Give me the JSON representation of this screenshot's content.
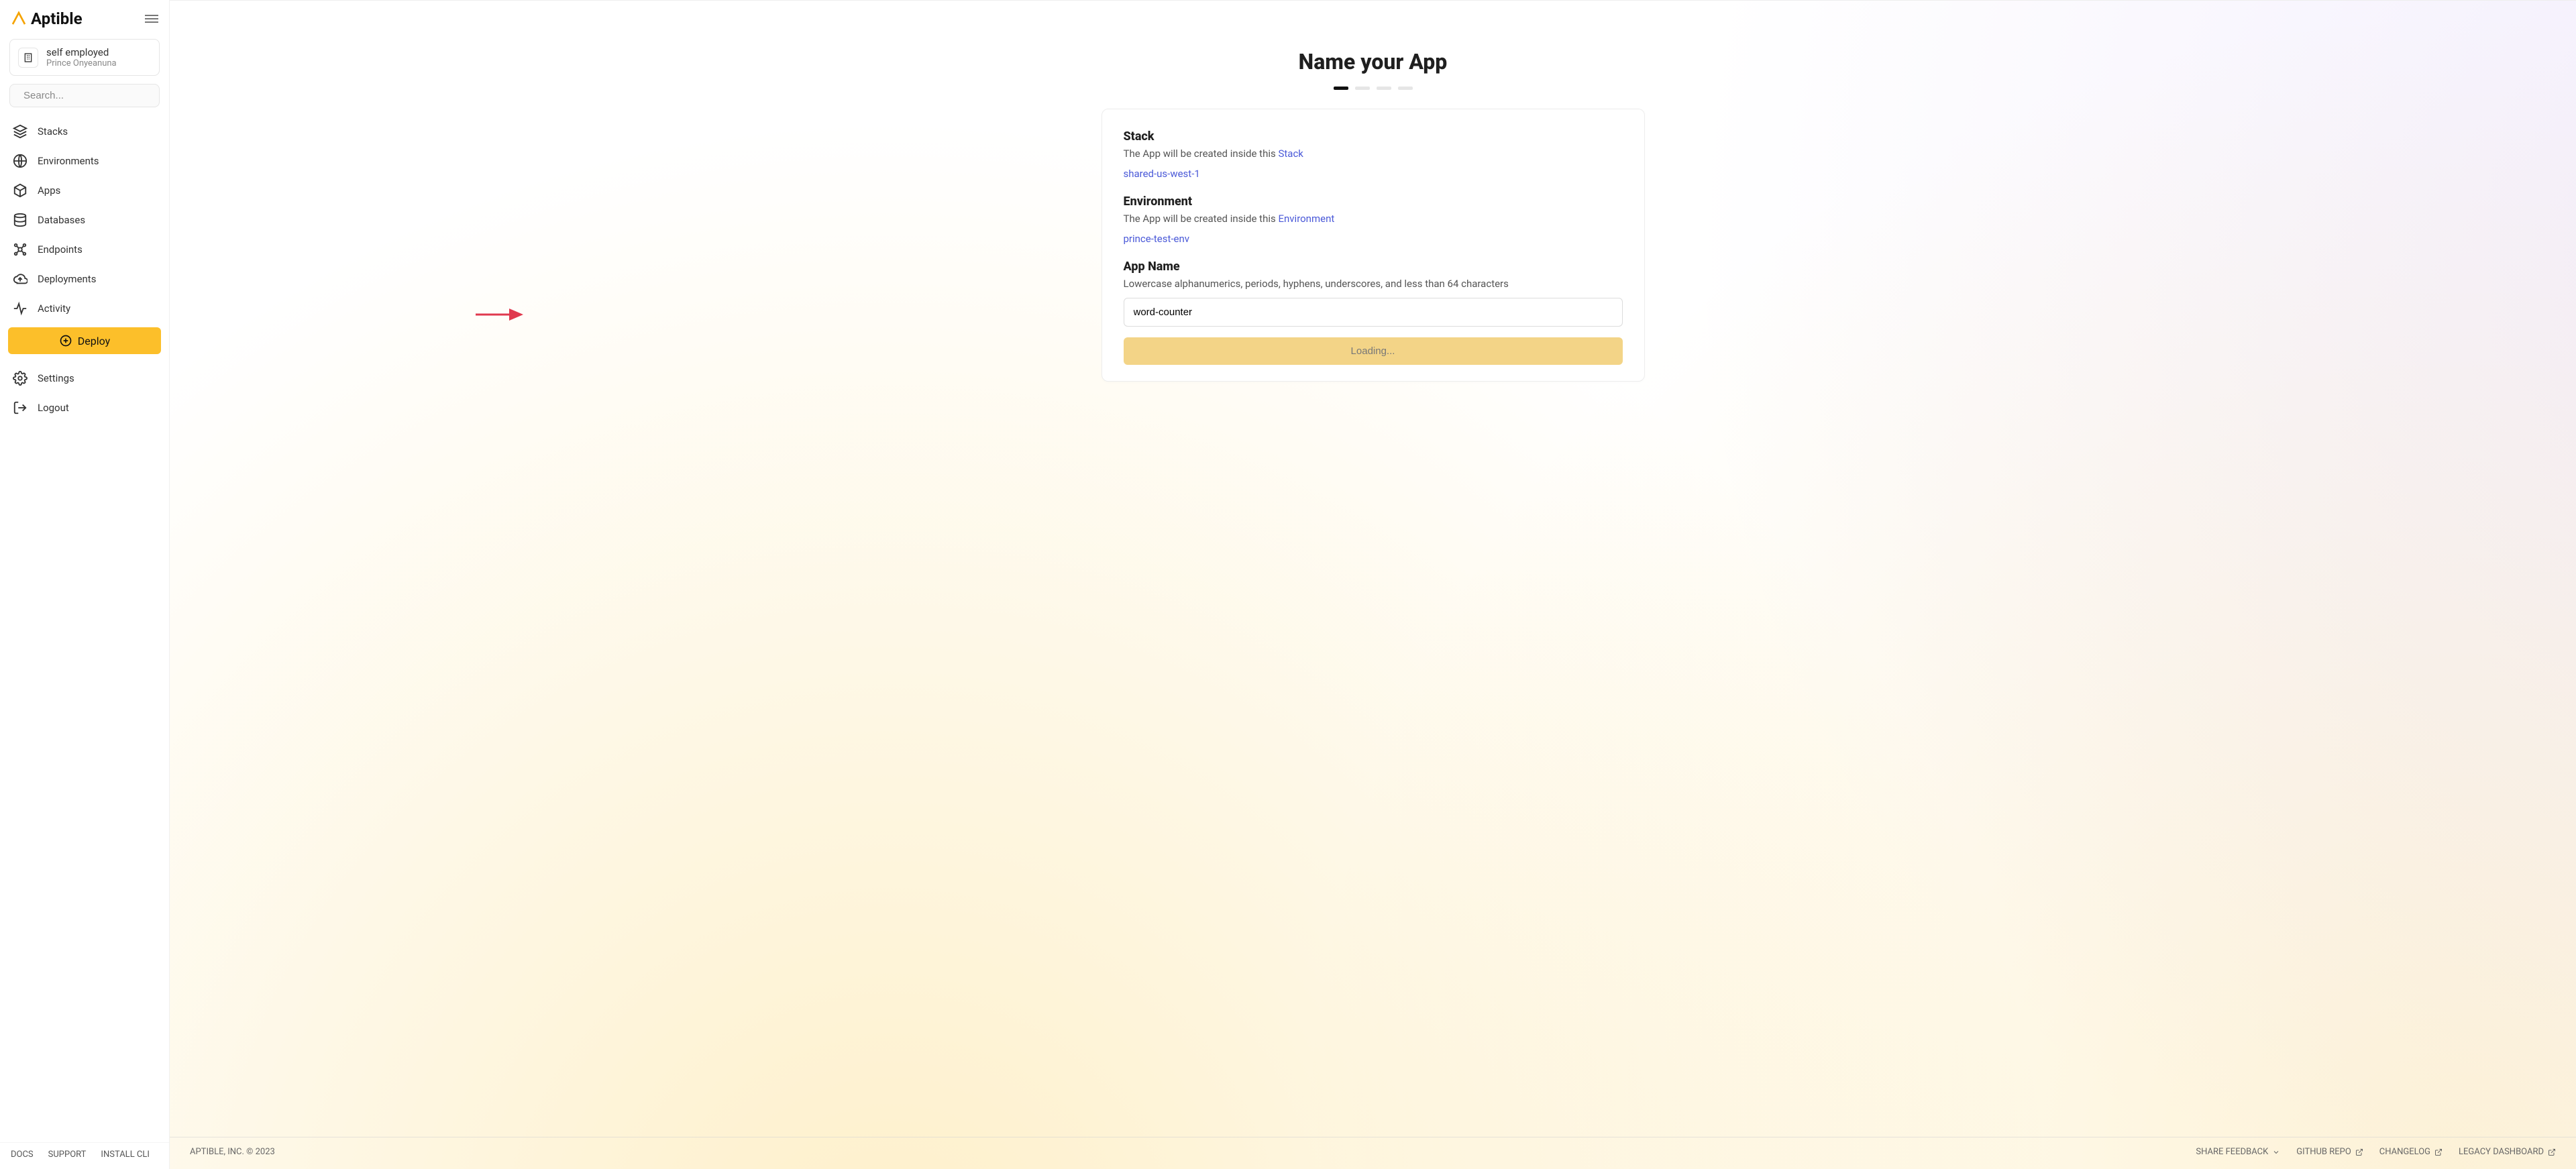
{
  "brand": {
    "name": "Aptible"
  },
  "org": {
    "title": "self employed",
    "sub": "Prince Onyeanuna"
  },
  "search": {
    "placeholder": "Search..."
  },
  "nav": {
    "stacks": "Stacks",
    "environments": "Environments",
    "apps": "Apps",
    "databases": "Databases",
    "endpoints": "Endpoints",
    "deployments": "Deployments",
    "activity": "Activity",
    "deploy_btn": "Deploy",
    "settings": "Settings",
    "logout": "Logout"
  },
  "bottom_links": {
    "docs": "DOCS",
    "support": "SUPPORT",
    "install_cli": "INSTALL CLI"
  },
  "page": {
    "title": "Name your App"
  },
  "form": {
    "stack": {
      "head": "Stack",
      "desc_pre": "The App will be created inside this ",
      "desc_link": "Stack",
      "value": "shared-us-west-1"
    },
    "env": {
      "head": "Environment",
      "desc_pre": "The App will be created inside this ",
      "desc_link": "Environment",
      "value": "prince-test-env"
    },
    "name": {
      "head": "App Name",
      "desc": "Lowercase alphanumerics, periods, hyphens, underscores, and less than 64 characters",
      "value": "word-counter"
    },
    "submit_label": "Loading..."
  },
  "footer": {
    "copyright": "APTIBLE, INC. © 2023",
    "share_feedback": "SHARE FEEDBACK",
    "github_repo": "GITHUB REPO",
    "changelog": "CHANGELOG",
    "legacy_dashboard": "LEGACY DASHBOARD"
  }
}
